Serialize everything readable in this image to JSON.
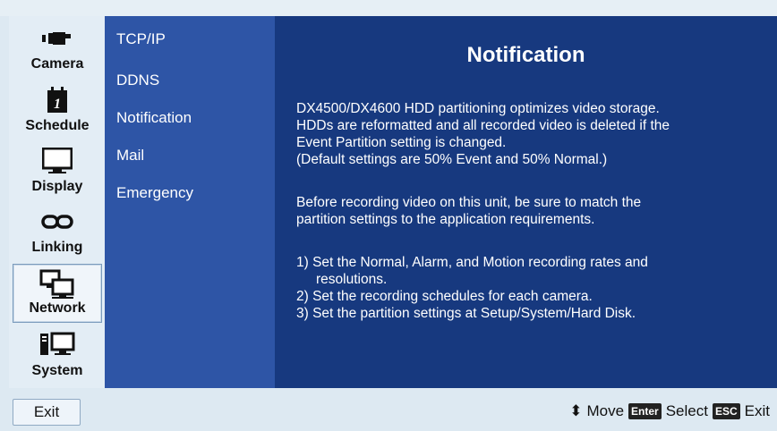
{
  "categories": [
    {
      "label": "Camera",
      "icon": "camera-icon"
    },
    {
      "label": "Schedule",
      "icon": "calendar-icon"
    },
    {
      "label": "Display",
      "icon": "monitor-icon"
    },
    {
      "label": "Linking",
      "icon": "chain-link-icon"
    },
    {
      "label": "Network",
      "icon": "network-icon",
      "active": true
    },
    {
      "label": "System",
      "icon": "computer-icon"
    }
  ],
  "submenu": [
    "TCP/IP",
    "DDNS",
    "Notification",
    "Mail",
    "Emergency"
  ],
  "content": {
    "title": "Notification",
    "lines": [
      "DX4500/DX4600 HDD partitioning optimizes video storage.",
      "HDDs are reformatted and all recorded video is deleted if the",
      "Event Partition setting is changed.",
      "(Default settings are 50% Event and 50% Normal.)",
      "Before recording video on this unit, be sure to match the",
      "partition settings to the application requirements.",
      "1)  Set the Normal, Alarm, and Motion recording rates and",
      "resolutions.",
      "2)  Set the recording schedules for each camera.",
      "3)  Set the partition settings at Setup/System/Hard Disk."
    ]
  },
  "footer": {
    "exit_label": "Exit",
    "move_glyph": "⬍",
    "move_label": "Move",
    "enter_key": "Enter",
    "select_label": "Select",
    "esc_key": "ESC",
    "exit_hint": "Exit"
  },
  "colors": {
    "menu_panel": "#2e55a6",
    "content_panel": "#17397f",
    "background": "#dde9f2"
  }
}
